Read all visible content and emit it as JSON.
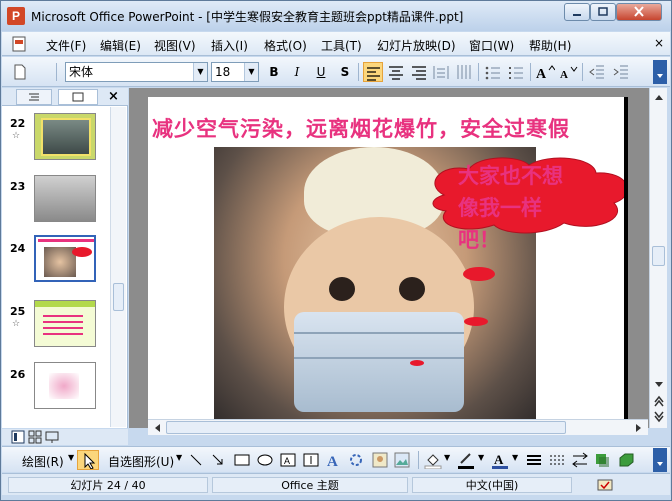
{
  "window": {
    "app_icon": "P",
    "title": "Microsoft Office PowerPoint - [中学生寒假安全教育主题班会ppt精品课件.ppt]"
  },
  "menu": {
    "items": [
      "文件(F)",
      "编辑(E)",
      "视图(V)",
      "插入(I)",
      "格式(O)",
      "工具(T)",
      "幻灯片放映(D)",
      "窗口(W)",
      "帮助(H)"
    ]
  },
  "toolbar": {
    "font_name": "宋体",
    "font_size": "18",
    "bold": "B",
    "italic": "I",
    "underline": "U",
    "shadow": "S",
    "icons": [
      "new-doc-icon",
      "align-left-icon",
      "align-center-icon",
      "align-right-icon",
      "numbered-list-icon",
      "bullet-list-icon",
      "increase-font-icon",
      "decrease-font-icon"
    ]
  },
  "left_pane": {
    "tabs": [
      "outline-tab",
      "slides-tab"
    ],
    "close": "×",
    "slides": [
      {
        "num": "22",
        "star": "☆"
      },
      {
        "num": "23",
        "star": ""
      },
      {
        "num": "24",
        "star": ""
      },
      {
        "num": "25",
        "star": "☆"
      },
      {
        "num": "26",
        "star": ""
      }
    ]
  },
  "slide": {
    "title": "减少空气污染，远离烟花爆竹，安全过寒假",
    "bubble_text": "大家也不想\n像我一样\n吧！",
    "accent_color": "#e8327f",
    "cloud_color": "#e8192c"
  },
  "drawbar": {
    "draw_label": "绘图(R)",
    "autoshapes_label": "自选图形(U)"
  },
  "status": {
    "slide_info": "幻灯片 24 / 40",
    "theme": "Office 主题",
    "language": "中文(中国)"
  }
}
